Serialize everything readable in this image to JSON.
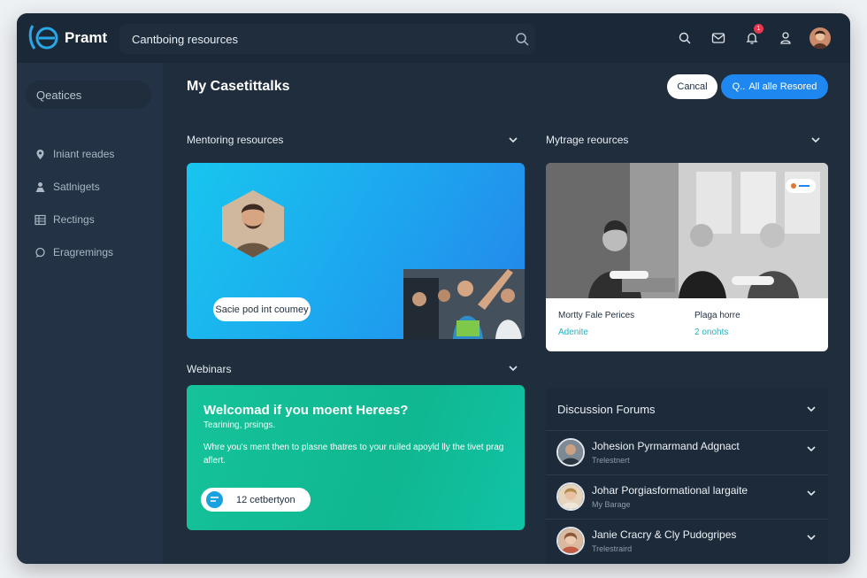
{
  "app": {
    "brand": "Pramt"
  },
  "search": {
    "value": "Cantboing resources"
  },
  "topbar": {
    "notification_count": "1"
  },
  "sidebar": {
    "search_placeholder": "Qeatices",
    "items": [
      {
        "label": "Iniant reades",
        "icon": "location-pin-icon"
      },
      {
        "label": "Satlnigets",
        "icon": "person-icon"
      },
      {
        "label": "Rectings",
        "icon": "grid-icon"
      },
      {
        "label": "Eragremings",
        "icon": "chat-icon"
      }
    ]
  },
  "header": {
    "title": "My Casetittalks",
    "cancel_label": "Cancal",
    "primary_label": "All alle Resored",
    "primary_prefix": "Q.."
  },
  "sections": {
    "mentoring": {
      "title": "Mentoring resources",
      "pill": "Sacie pod int coumey"
    },
    "image": {
      "title": "Mytrage reources",
      "left_caption": "Mortty Fale Perices",
      "left_sub": "Adenite",
      "right_caption": "Plaga horre",
      "right_sub": "2 onohts"
    },
    "webinars": {
      "title": "Webinars",
      "card_title": "Welcomad if you moent Herees?",
      "card_sub": "Tearining, prsings.",
      "card_body": "Whre you's ment then to plasne thatres to your ruiled apoyld lly the tivet prag aflert.",
      "card_pill": "12 cetbertyon"
    },
    "forums": {
      "title": "Discussion Forums",
      "rows": [
        {
          "title": "Johesion Pyrmarmand Adgnact",
          "sub": "Trelestnert"
        },
        {
          "title": "Johar Porgiasformational largaite",
          "sub": "My Barage"
        },
        {
          "title": "Janie Cracry & Cly Pudogripes",
          "sub": "Trelestraird"
        }
      ]
    }
  },
  "colors": {
    "background": "#1f2d3d",
    "sidebar": "#233345",
    "accent_blue": "#1e88f0",
    "card_blue": "#1da5ef",
    "card_green": "#15c39b",
    "badge_red": "#e53950"
  }
}
